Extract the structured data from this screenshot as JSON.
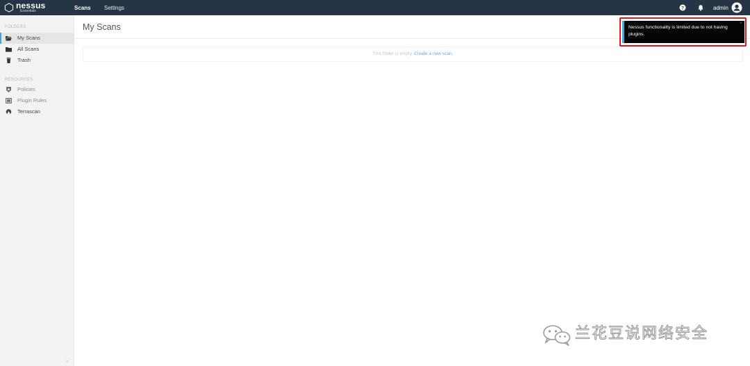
{
  "topbar": {
    "logo_word": "nessus",
    "logo_sub": "Essentials",
    "nav": [
      {
        "label": "Scans",
        "icon": "none"
      },
      {
        "label": "Settings",
        "icon": "none"
      }
    ],
    "help_icon": "help-circle-icon",
    "bell_icon": "bell-icon",
    "user_label": "admin",
    "avatar_icon": "user-avatar-icon",
    "colors": {
      "bar": "#263545",
      "accent": "#3fa7d6"
    }
  },
  "sidebar": {
    "folders_title": "FOLDERS",
    "folders": [
      {
        "label": "My Scans",
        "icon": "folder-open-icon",
        "active": true
      },
      {
        "label": "All Scans",
        "icon": "folder-icon"
      },
      {
        "label": "Trash",
        "icon": "trash-icon"
      }
    ],
    "resources_title": "RESOURCES",
    "resources": [
      {
        "label": "Policies",
        "icon": "shield-icon"
      },
      {
        "label": "Plugin Rules",
        "icon": "plugin-rules-icon"
      },
      {
        "label": "Terrascan",
        "icon": "terrascan-icon"
      }
    ],
    "collapse_label": "«"
  },
  "main": {
    "title": "My Scans",
    "empty_text": "This folder is empty.",
    "empty_link": "Create a new scan."
  },
  "toast": {
    "message": "Nessus functionality is limited due to not having plugins.",
    "close_label": "×",
    "highlight_color": "#e0151b"
  },
  "watermark": {
    "text": "兰花豆说网络安全",
    "icon": "wechat-icon"
  }
}
